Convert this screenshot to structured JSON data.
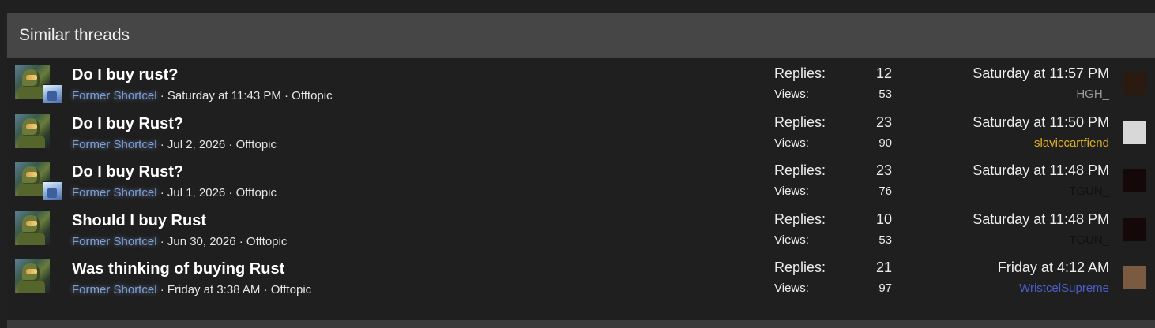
{
  "section": {
    "title": "Similar threads"
  },
  "labels": {
    "replies": "Replies:",
    "views": "Views:"
  },
  "threads": [
    {
      "title": "Do I buy rust?",
      "author": "Former Shortcel",
      "meta": " · Saturday at 11:43 PM · Offtopic",
      "replies": "12",
      "views": "53",
      "last_date": "Saturday at 11:57 PM",
      "last_user": "HGH_",
      "last_user_color": "#9a9a9a",
      "last_avatar_color": "#2a1a10",
      "has_mini_avatar": true
    },
    {
      "title": "Do I buy Rust?",
      "author": "Former Shortcel",
      "meta": " · Jul 2, 2026 · Offtopic",
      "replies": "23",
      "views": "90",
      "last_date": "Saturday at 11:50 PM",
      "last_user": "slaviccartfiend",
      "last_user_color": "#e0b020",
      "last_avatar_color": "#d8d8d8",
      "has_mini_avatar": false
    },
    {
      "title": "Do I buy Rust?",
      "author": "Former Shortcel",
      "meta": " · Jul 1, 2026 · Offtopic",
      "replies": "23",
      "views": "76",
      "last_date": "Saturday at 11:48 PM",
      "last_user": "TGUN_",
      "last_user_color": "#111111",
      "last_avatar_color": "#140808",
      "has_mini_avatar": true
    },
    {
      "title": "Should I buy Rust",
      "author": "Former Shortcel",
      "meta": " · Jun 30, 2026 · Offtopic",
      "replies": "10",
      "views": "53",
      "last_date": "Saturday at 11:48 PM",
      "last_user": "TGUN_",
      "last_user_color": "#111111",
      "last_avatar_color": "#140808",
      "has_mini_avatar": false
    },
    {
      "title": "Was thinking of buying Rust",
      "author": "Former Shortcel",
      "meta": " · Friday at 3:38 AM · Offtopic",
      "replies": "21",
      "views": "97",
      "last_date": "Friday at 4:12 AM",
      "last_user": "WristcelSupreme",
      "last_user_color": "#4a5fc8",
      "last_avatar_color": "#7a5a40",
      "has_mini_avatar": false
    }
  ]
}
